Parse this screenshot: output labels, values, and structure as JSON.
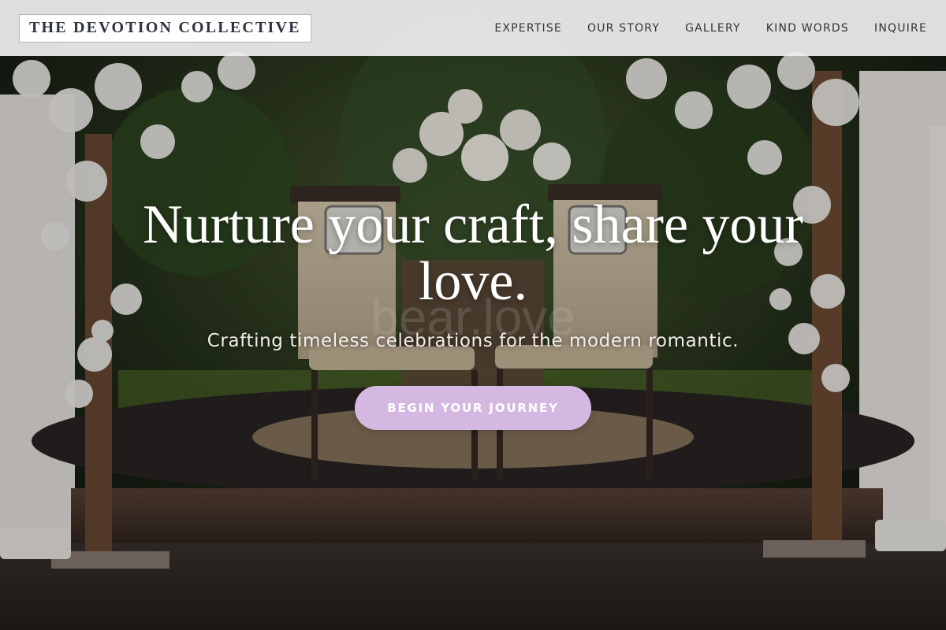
{
  "brand": {
    "logo_text": "THE DEVOTION COLLECTIVE"
  },
  "nav": {
    "items": [
      {
        "label": "EXPERTISE"
      },
      {
        "label": "OUR STORY"
      },
      {
        "label": "GALLERY"
      },
      {
        "label": "KIND WORDS"
      },
      {
        "label": "INQUIRE"
      }
    ]
  },
  "hero": {
    "title": "Nurture your craft, share your love.",
    "subtitle": "Crafting timeless celebrations for the modern romantic.",
    "cta_label": "BEGIN YOUR JOURNEY",
    "background_text": "bear.love",
    "background_description_hidden": ""
  },
  "colors": {
    "header_bg": "#eeeeee",
    "logo_text": "#2e3340",
    "cta_bg": "#d5b8e2",
    "hero_text": "#ffffff"
  }
}
